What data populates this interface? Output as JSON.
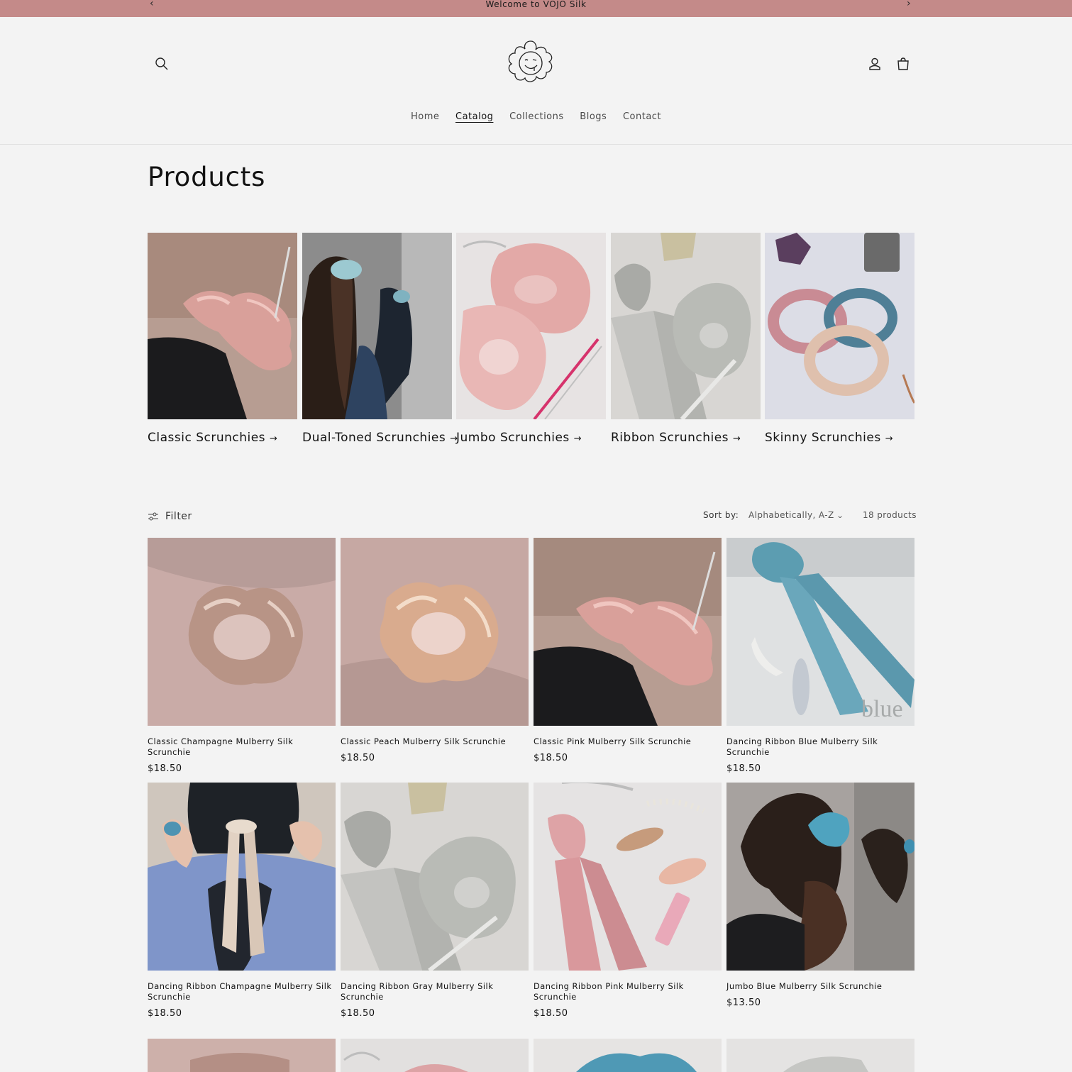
{
  "announcement": {
    "text": "Welcome to VOJO Silk",
    "prev": "‹",
    "next": "›"
  },
  "header": {
    "nav": [
      {
        "label": "Home"
      },
      {
        "label": "Catalog"
      },
      {
        "label": "Collections"
      },
      {
        "label": "Blogs"
      },
      {
        "label": "Contact"
      }
    ],
    "icons": {
      "search": "search-icon",
      "account": "account-icon",
      "cart": "cart-icon",
      "logo": "smiling-flower-logo"
    }
  },
  "page": {
    "title": "Products"
  },
  "collections": [
    {
      "label": "Classic Scrunchies",
      "arrow": "→"
    },
    {
      "label": "Dual-Toned Scrunchies",
      "arrow": "→"
    },
    {
      "label": "Jumbo Scrunchies",
      "arrow": "→"
    },
    {
      "label": "Ribbon Scrunchies",
      "arrow": "→"
    },
    {
      "label": "Skinny Scrunchies",
      "arrow": "→"
    }
  ],
  "toolbar": {
    "filter_label": "Filter",
    "sort_label": "Sort by:",
    "sort_value": "Alphabetically, A-Z",
    "count": "18 products"
  },
  "products": [
    {
      "title": "Classic Champagne Mulberry Silk Scrunchie",
      "price": "$18.50"
    },
    {
      "title": "Classic Peach Mulberry Silk Scrunchie",
      "price": "$18.50"
    },
    {
      "title": "Classic Pink Mulberry Silk Scrunchie",
      "price": "$18.50"
    },
    {
      "title": "Dancing Ribbon Blue Mulberry Silk Scrunchie",
      "price": "$18.50"
    },
    {
      "title": "Dancing Ribbon Champagne Mulberry Silk Scrunchie",
      "price": "$18.50"
    },
    {
      "title": "Dancing Ribbon Gray Mulberry Silk Scrunchie",
      "price": "$18.50"
    },
    {
      "title": "Dancing Ribbon Pink Mulberry Silk Scrunchie",
      "price": "$18.50"
    },
    {
      "title": "Jumbo Blue Mulberry Silk Scrunchie",
      "price": "$13.50"
    }
  ],
  "image_watermark": "blue",
  "colors": {
    "announcement_bg": "#c48a89",
    "page_bg": "#f3f3f3",
    "text": "#121212"
  }
}
